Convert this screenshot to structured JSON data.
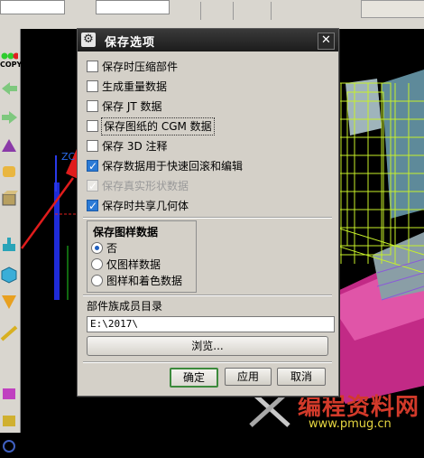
{
  "background": {
    "toolbar_copy_label": "COPY",
    "viewport_hint": "ZC"
  },
  "dialog": {
    "title": "保存选项",
    "options": [
      {
        "label": "保存时压缩部件",
        "checked": false,
        "enabled": true
      },
      {
        "label": "生成重量数据",
        "checked": false,
        "enabled": true
      },
      {
        "label": "保存 JT 数据",
        "checked": false,
        "enabled": true
      },
      {
        "label": "保存图纸的 CGM 数据",
        "checked": false,
        "enabled": true
      },
      {
        "label": "保存 3D 注释",
        "checked": false,
        "enabled": true
      },
      {
        "label": "保存数据用于快速回滚和编辑",
        "checked": true,
        "enabled": true
      },
      {
        "label": "保存真实形状数据",
        "checked": true,
        "enabled": false
      },
      {
        "label": "保存时共享几何体",
        "checked": true,
        "enabled": true
      }
    ],
    "pattern_group": {
      "title": "保存图样数据",
      "options": [
        "否",
        "仅图样数据",
        "图样和着色数据"
      ],
      "selected_index": 0
    },
    "family_dir_label": "部件族成员目录",
    "family_dir_value": "E:\\2017\\",
    "browse_label": "浏览...",
    "ok_label": "确定",
    "apply_label": "应用",
    "cancel_label": "取消"
  },
  "watermark": {
    "text": "编程资料网",
    "url": "www.pmug.cn"
  }
}
